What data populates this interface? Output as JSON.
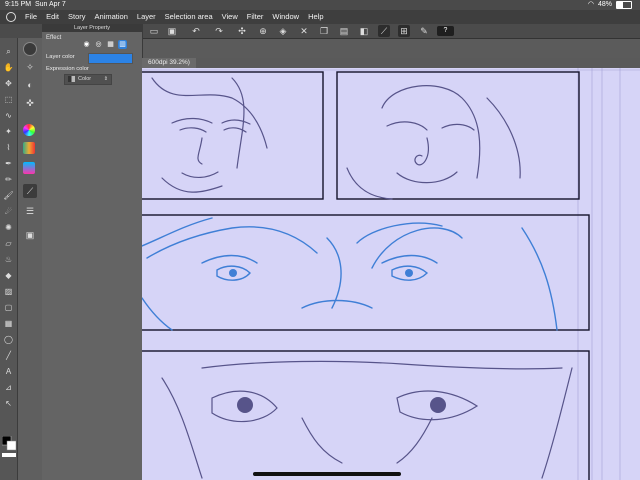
{
  "status": {
    "time": "9:15 PM",
    "date": "Sun Apr 7",
    "battery": "48%"
  },
  "menu": [
    "File",
    "Edit",
    "Story",
    "Animation",
    "Layer",
    "Selection area",
    "View",
    "Filter",
    "Window",
    "Help"
  ],
  "toolbar": {
    "help_label": "?"
  },
  "panel": {
    "title": "Layer Property",
    "effect_label": "Effect",
    "layer_color_label": "Layer color",
    "layer_color": "#2c83e6",
    "expression_label": "Expression color",
    "expression_value": "Color"
  },
  "canvas": {
    "tab_label": "600dpi 39.2%)",
    "paper_color": "#d6d4f7",
    "line_color": "#59558a",
    "blue_line_color": "#3f7fd6"
  }
}
